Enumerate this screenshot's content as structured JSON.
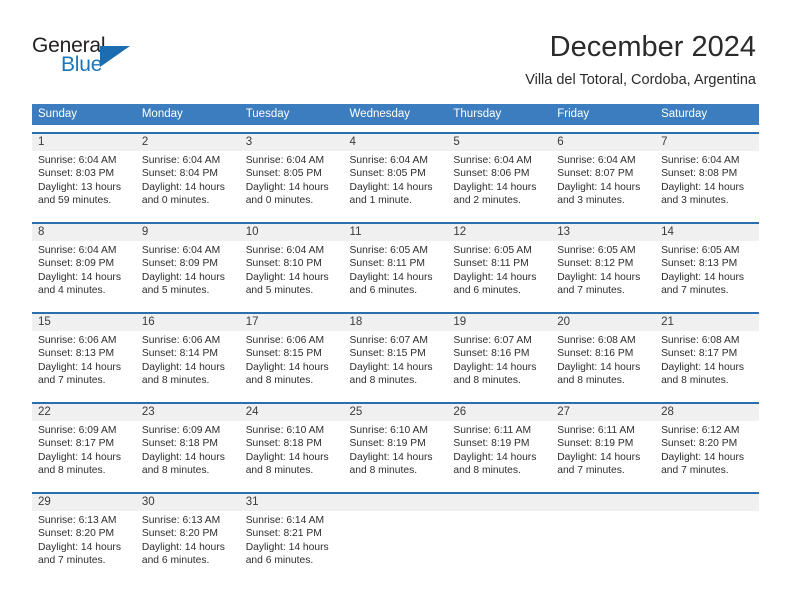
{
  "brand": {
    "name_top": "General",
    "name_bottom": "Blue",
    "triangle_icon": "blue-triangle-logo",
    "color_dark": "#231f20",
    "color_blue": "#1b76bc"
  },
  "header": {
    "title": "December 2024",
    "location": "Villa del Totoral, Cordoba, Argentina"
  },
  "theme": {
    "header_blue": "#3b7dbf",
    "rule_blue": "#2a6ead",
    "number_band_gray": "#f0f0f0",
    "cell_white": "#ffffff",
    "text_dark": "#2e2e2e"
  },
  "calendar": {
    "weekday_headers": [
      "Sunday",
      "Monday",
      "Tuesday",
      "Wednesday",
      "Thursday",
      "Friday",
      "Saturday"
    ],
    "weeks": [
      {
        "days": [
          {
            "num": "1",
            "l1": "Sunrise: 6:04 AM",
            "l2": "Sunset: 8:03 PM",
            "l3": "Daylight: 13 hours",
            "l4": "and 59 minutes."
          },
          {
            "num": "2",
            "l1": "Sunrise: 6:04 AM",
            "l2": "Sunset: 8:04 PM",
            "l3": "Daylight: 14 hours",
            "l4": "and 0 minutes."
          },
          {
            "num": "3",
            "l1": "Sunrise: 6:04 AM",
            "l2": "Sunset: 8:05 PM",
            "l3": "Daylight: 14 hours",
            "l4": "and 0 minutes."
          },
          {
            "num": "4",
            "l1": "Sunrise: 6:04 AM",
            "l2": "Sunset: 8:05 PM",
            "l3": "Daylight: 14 hours",
            "l4": "and 1 minute."
          },
          {
            "num": "5",
            "l1": "Sunrise: 6:04 AM",
            "l2": "Sunset: 8:06 PM",
            "l3": "Daylight: 14 hours",
            "l4": "and 2 minutes."
          },
          {
            "num": "6",
            "l1": "Sunrise: 6:04 AM",
            "l2": "Sunset: 8:07 PM",
            "l3": "Daylight: 14 hours",
            "l4": "and 3 minutes."
          },
          {
            "num": "7",
            "l1": "Sunrise: 6:04 AM",
            "l2": "Sunset: 8:08 PM",
            "l3": "Daylight: 14 hours",
            "l4": "and 3 minutes."
          }
        ]
      },
      {
        "days": [
          {
            "num": "8",
            "l1": "Sunrise: 6:04 AM",
            "l2": "Sunset: 8:09 PM",
            "l3": "Daylight: 14 hours",
            "l4": "and 4 minutes."
          },
          {
            "num": "9",
            "l1": "Sunrise: 6:04 AM",
            "l2": "Sunset: 8:09 PM",
            "l3": "Daylight: 14 hours",
            "l4": "and 5 minutes."
          },
          {
            "num": "10",
            "l1": "Sunrise: 6:04 AM",
            "l2": "Sunset: 8:10 PM",
            "l3": "Daylight: 14 hours",
            "l4": "and 5 minutes."
          },
          {
            "num": "11",
            "l1": "Sunrise: 6:05 AM",
            "l2": "Sunset: 8:11 PM",
            "l3": "Daylight: 14 hours",
            "l4": "and 6 minutes."
          },
          {
            "num": "12",
            "l1": "Sunrise: 6:05 AM",
            "l2": "Sunset: 8:11 PM",
            "l3": "Daylight: 14 hours",
            "l4": "and 6 minutes."
          },
          {
            "num": "13",
            "l1": "Sunrise: 6:05 AM",
            "l2": "Sunset: 8:12 PM",
            "l3": "Daylight: 14 hours",
            "l4": "and 7 minutes."
          },
          {
            "num": "14",
            "l1": "Sunrise: 6:05 AM",
            "l2": "Sunset: 8:13 PM",
            "l3": "Daylight: 14 hours",
            "l4": "and 7 minutes."
          }
        ]
      },
      {
        "days": [
          {
            "num": "15",
            "l1": "Sunrise: 6:06 AM",
            "l2": "Sunset: 8:13 PM",
            "l3": "Daylight: 14 hours",
            "l4": "and 7 minutes."
          },
          {
            "num": "16",
            "l1": "Sunrise: 6:06 AM",
            "l2": "Sunset: 8:14 PM",
            "l3": "Daylight: 14 hours",
            "l4": "and 8 minutes."
          },
          {
            "num": "17",
            "l1": "Sunrise: 6:06 AM",
            "l2": "Sunset: 8:15 PM",
            "l3": "Daylight: 14 hours",
            "l4": "and 8 minutes."
          },
          {
            "num": "18",
            "l1": "Sunrise: 6:07 AM",
            "l2": "Sunset: 8:15 PM",
            "l3": "Daylight: 14 hours",
            "l4": "and 8 minutes."
          },
          {
            "num": "19",
            "l1": "Sunrise: 6:07 AM",
            "l2": "Sunset: 8:16 PM",
            "l3": "Daylight: 14 hours",
            "l4": "and 8 minutes."
          },
          {
            "num": "20",
            "l1": "Sunrise: 6:08 AM",
            "l2": "Sunset: 8:16 PM",
            "l3": "Daylight: 14 hours",
            "l4": "and 8 minutes."
          },
          {
            "num": "21",
            "l1": "Sunrise: 6:08 AM",
            "l2": "Sunset: 8:17 PM",
            "l3": "Daylight: 14 hours",
            "l4": "and 8 minutes."
          }
        ]
      },
      {
        "days": [
          {
            "num": "22",
            "l1": "Sunrise: 6:09 AM",
            "l2": "Sunset: 8:17 PM",
            "l3": "Daylight: 14 hours",
            "l4": "and 8 minutes."
          },
          {
            "num": "23",
            "l1": "Sunrise: 6:09 AM",
            "l2": "Sunset: 8:18 PM",
            "l3": "Daylight: 14 hours",
            "l4": "and 8 minutes."
          },
          {
            "num": "24",
            "l1": "Sunrise: 6:10 AM",
            "l2": "Sunset: 8:18 PM",
            "l3": "Daylight: 14 hours",
            "l4": "and 8 minutes."
          },
          {
            "num": "25",
            "l1": "Sunrise: 6:10 AM",
            "l2": "Sunset: 8:19 PM",
            "l3": "Daylight: 14 hours",
            "l4": "and 8 minutes."
          },
          {
            "num": "26",
            "l1": "Sunrise: 6:11 AM",
            "l2": "Sunset: 8:19 PM",
            "l3": "Daylight: 14 hours",
            "l4": "and 8 minutes."
          },
          {
            "num": "27",
            "l1": "Sunrise: 6:11 AM",
            "l2": "Sunset: 8:19 PM",
            "l3": "Daylight: 14 hours",
            "l4": "and 7 minutes."
          },
          {
            "num": "28",
            "l1": "Sunrise: 6:12 AM",
            "l2": "Sunset: 8:20 PM",
            "l3": "Daylight: 14 hours",
            "l4": "and 7 minutes."
          }
        ]
      },
      {
        "days": [
          {
            "num": "29",
            "l1": "Sunrise: 6:13 AM",
            "l2": "Sunset: 8:20 PM",
            "l3": "Daylight: 14 hours",
            "l4": "and 7 minutes."
          },
          {
            "num": "30",
            "l1": "Sunrise: 6:13 AM",
            "l2": "Sunset: 8:20 PM",
            "l3": "Daylight: 14 hours",
            "l4": "and 6 minutes."
          },
          {
            "num": "31",
            "l1": "Sunrise: 6:14 AM",
            "l2": "Sunset: 8:21 PM",
            "l3": "Daylight: 14 hours",
            "l4": "and 6 minutes."
          },
          {
            "num": "",
            "l1": "",
            "l2": "",
            "l3": "",
            "l4": ""
          },
          {
            "num": "",
            "l1": "",
            "l2": "",
            "l3": "",
            "l4": ""
          },
          {
            "num": "",
            "l1": "",
            "l2": "",
            "l3": "",
            "l4": ""
          },
          {
            "num": "",
            "l1": "",
            "l2": "",
            "l3": "",
            "l4": ""
          }
        ]
      }
    ]
  }
}
